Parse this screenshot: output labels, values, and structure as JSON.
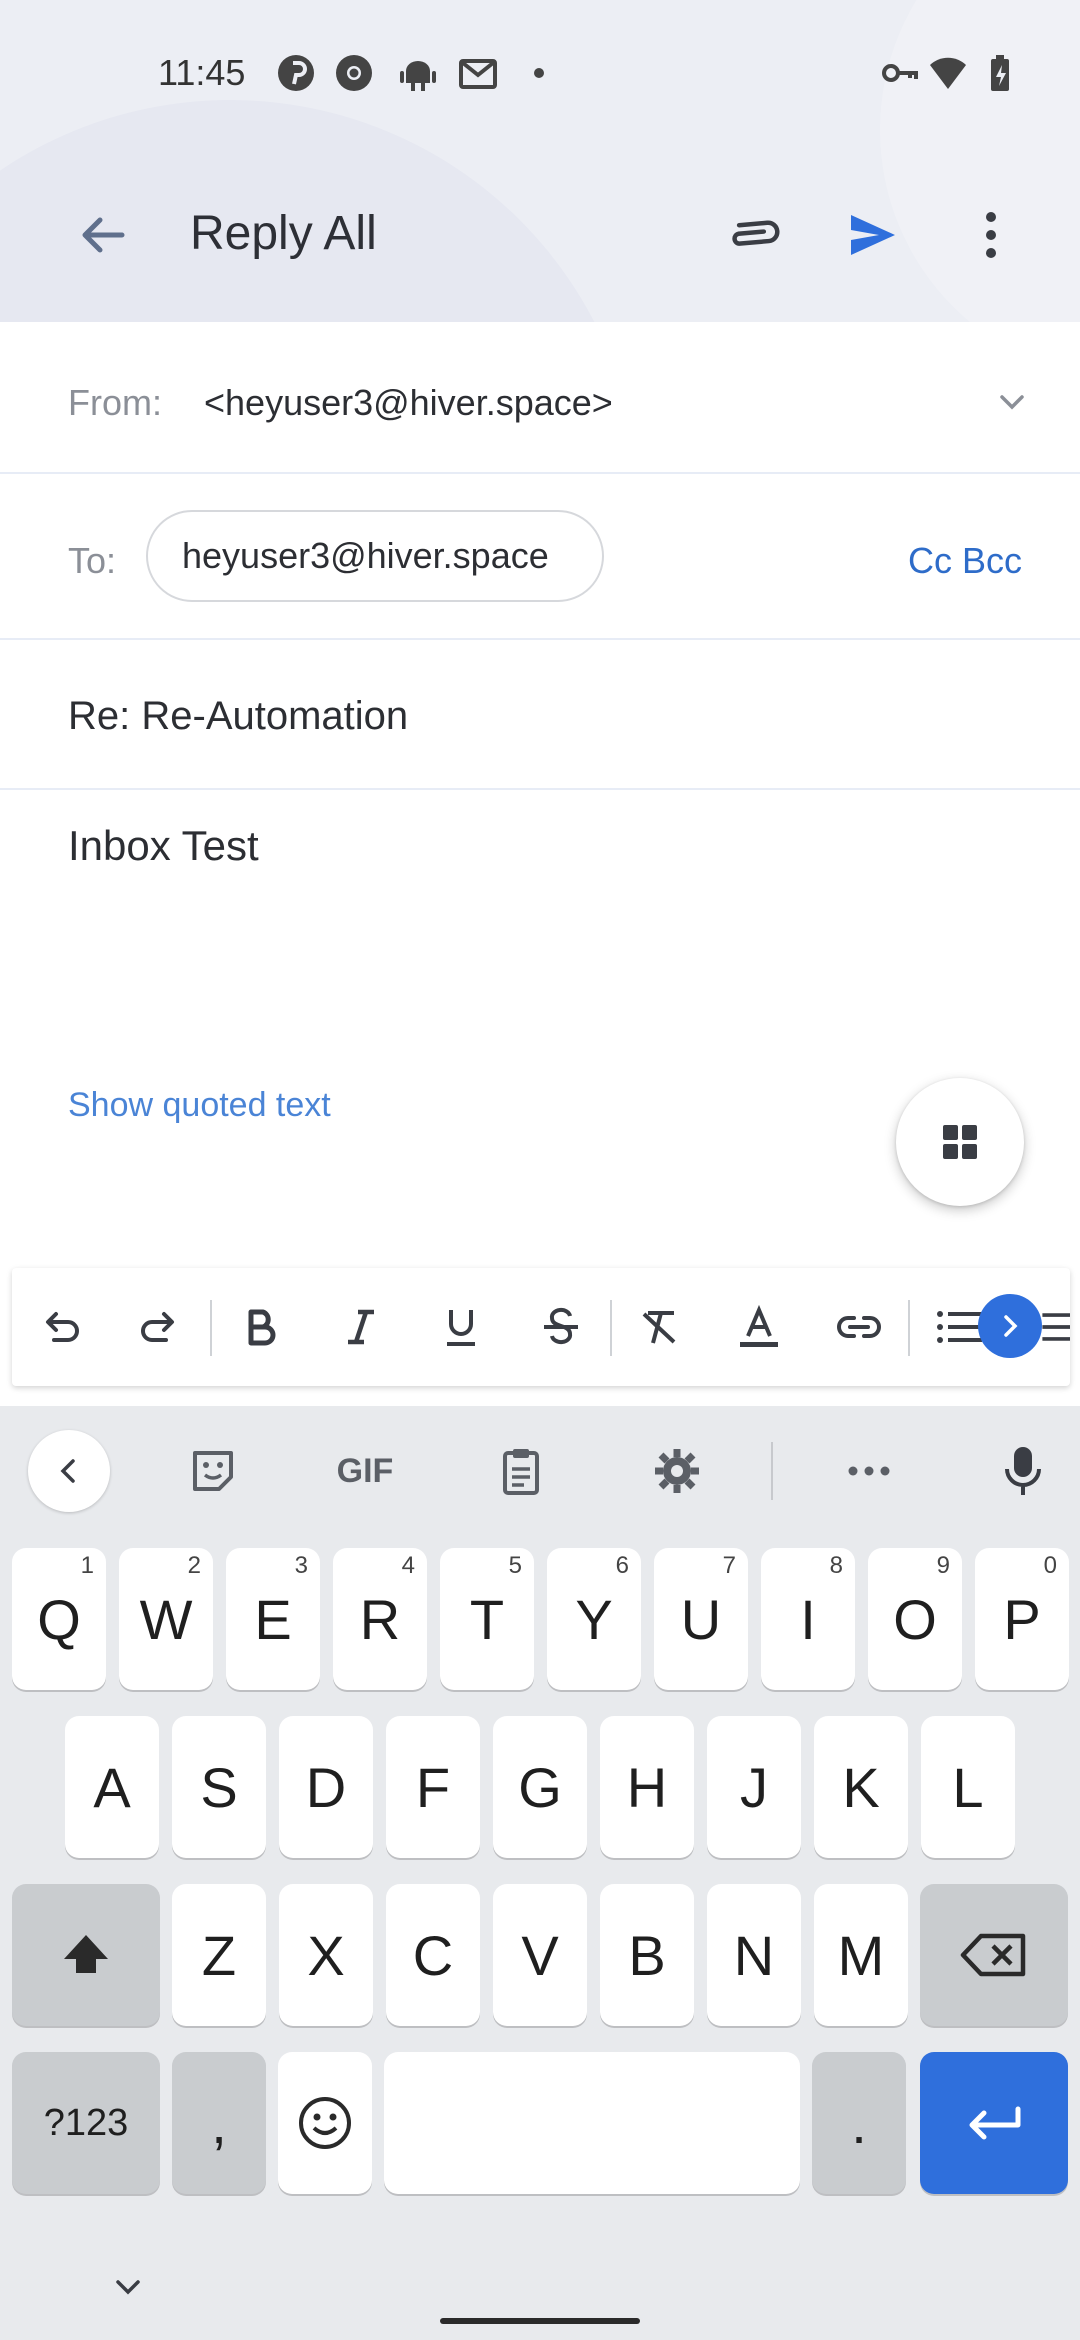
{
  "status_bar": {
    "time": "11:45",
    "left_icons": [
      "pinterest-icon",
      "chrome-icon",
      "android-icon",
      "gmail-icon",
      "dot-icon"
    ],
    "right_icons": [
      "vpn-key-icon",
      "wifi-icon",
      "battery-charging-icon"
    ]
  },
  "toolbar": {
    "title": "Reply All",
    "icons": [
      "back-arrow-icon",
      "attach-icon",
      "send-icon",
      "more-vert-icon"
    ],
    "accent_color": "#2f6fdc"
  },
  "compose": {
    "from_label": "From:",
    "from_value": "<heyuser3@hiver.space>",
    "to_label": "To:",
    "to_chip": "heyuser3@hiver.space",
    "cc_bcc": "Cc Bcc",
    "subject": "Re: Re-Automation",
    "body": "Inbox Test",
    "show_quoted": "Show quoted text"
  },
  "format_toolbar": {
    "tools": [
      "undo",
      "redo",
      "bold",
      "italic",
      "underline",
      "strikethrough",
      "clear-format",
      "text-color",
      "link",
      "bulleted-list",
      "numbered-list"
    ]
  },
  "keyboard": {
    "suggestion_tools": [
      "back",
      "sticker",
      "GIF",
      "clipboard",
      "settings",
      "more",
      "mic"
    ],
    "gif_label": "GIF",
    "row1": [
      {
        "k": "Q",
        "h": "1"
      },
      {
        "k": "W",
        "h": "2"
      },
      {
        "k": "E",
        "h": "3"
      },
      {
        "k": "R",
        "h": "4"
      },
      {
        "k": "T",
        "h": "5"
      },
      {
        "k": "Y",
        "h": "6"
      },
      {
        "k": "U",
        "h": "7"
      },
      {
        "k": "I",
        "h": "8"
      },
      {
        "k": "O",
        "h": "9"
      },
      {
        "k": "P",
        "h": "0"
      }
    ],
    "row2": [
      "A",
      "S",
      "D",
      "F",
      "G",
      "H",
      "J",
      "K",
      "L"
    ],
    "row3": [
      "Z",
      "X",
      "C",
      "V",
      "B",
      "N",
      "M"
    ],
    "symbols_key": "?123",
    "comma_key": ",",
    "period_key": "."
  }
}
